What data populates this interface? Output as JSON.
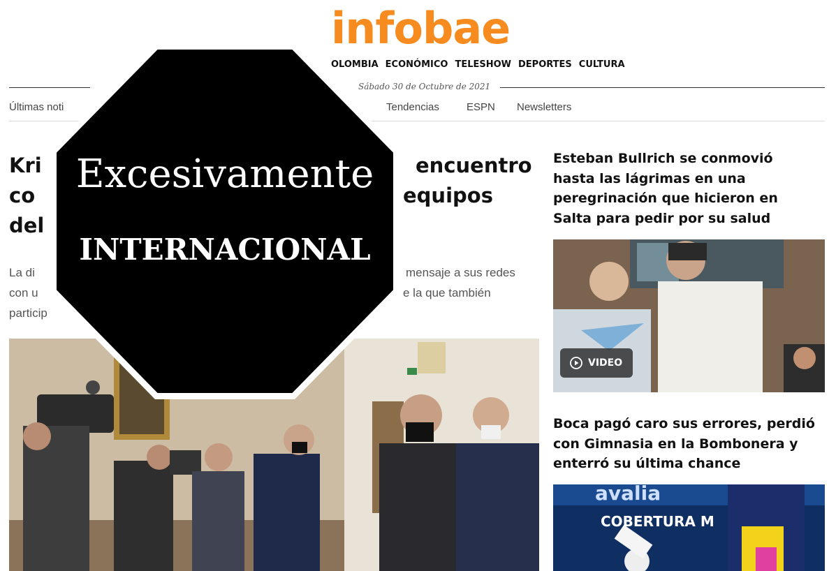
{
  "logo": "infobae",
  "top_nav": [
    "OLOMBIA",
    "ECONÓMICO",
    "TELESHOW",
    "DEPORTES",
    "CULTURA"
  ],
  "date": "Sábado 30 de Octubre de 2021",
  "section_nav": [
    "Últimas noti",
    "Tendencias",
    "ESPN",
    "Newsletters"
  ],
  "main_story": {
    "title_lines": [
      "Kri",
      "encuentro",
      "co",
      "equipos",
      "del"
    ],
    "summary_lines": [
      "La di",
      "mensaje a sus redes",
      "con u",
      "e la que también",
      "particip"
    ]
  },
  "side_stories": [
    {
      "title": "Esteban Bullrich se conmovió hasta las lágrimas en una peregrinación que hicieron en Salta para pedir por su salud",
      "badge": "VIDEO"
    },
    {
      "title": "Boca pagó caro sus errores, perdió con Gimnasia en la Bombonera y enterró su última chance",
      "sign_text": "COBERTURA M"
    }
  ],
  "overlay": {
    "word1": "Excesivamente",
    "word2": "INTERNACIONAL"
  },
  "colors": {
    "brand": "#f68b1f",
    "overlay": "#000000"
  }
}
